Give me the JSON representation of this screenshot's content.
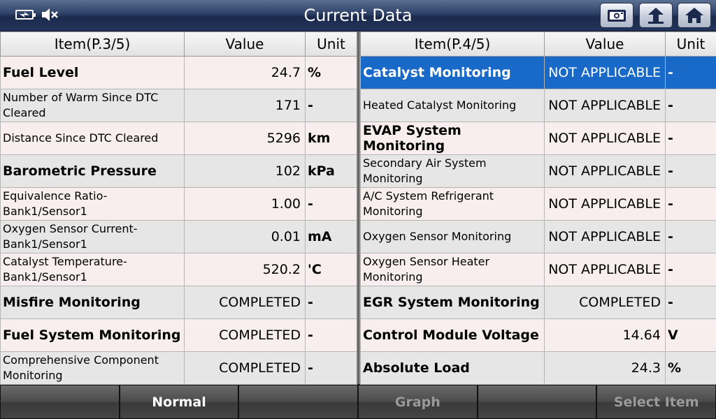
{
  "header": {
    "title": "Current Data",
    "icons": [
      "battery-charging-icon",
      "speaker-muted-icon"
    ],
    "buttons": [
      "screenshot-button",
      "back-button",
      "home-button"
    ]
  },
  "left_table": {
    "headers": {
      "item": "Item(P.3/5)",
      "value": "Value",
      "unit": "Unit"
    },
    "rows": [
      {
        "item": "Fuel Level",
        "value": "24.7",
        "unit": "%",
        "big": true
      },
      {
        "item": "Number of Warm Since DTC Cleared",
        "value": "171",
        "unit": "-"
      },
      {
        "item": "Distance Since DTC Cleared",
        "value": "5296",
        "unit": "km"
      },
      {
        "item": "Barometric Pressure",
        "value": "102",
        "unit": "kPa",
        "big": true
      },
      {
        "item": "Equivalence Ratio-Bank1/Sensor1",
        "value": "1.00",
        "unit": "-"
      },
      {
        "item": "Oxygen Sensor Current-Bank1/Sensor1",
        "value": "0.01",
        "unit": "mA"
      },
      {
        "item": "Catalyst Temperature-Bank1/Sensor1",
        "value": "520.2",
        "unit": "'C"
      },
      {
        "item": "Misfire Monitoring",
        "value": "COMPLETED",
        "unit": "-",
        "big": true
      },
      {
        "item": "Fuel System Monitoring",
        "value": "COMPLETED",
        "unit": "-",
        "big": true
      },
      {
        "item": "Comprehensive Component Monitoring",
        "value": "COMPLETED",
        "unit": "-"
      }
    ]
  },
  "right_table": {
    "headers": {
      "item": "Item(P.4/5)",
      "value": "Value",
      "unit": "Unit"
    },
    "rows": [
      {
        "item": "Catalyst Monitoring",
        "value": "NOT APPLICABLE",
        "unit": "-",
        "big": true,
        "selected": true
      },
      {
        "item": "Heated Catalyst Monitoring",
        "value": "NOT APPLICABLE",
        "unit": "-"
      },
      {
        "item": "EVAP System Monitoring",
        "value": "NOT APPLICABLE",
        "unit": "-",
        "big": true
      },
      {
        "item": "Secondary Air System Monitoring",
        "value": "NOT APPLICABLE",
        "unit": "-"
      },
      {
        "item": "A/C System Refrigerant Monitoring",
        "value": "NOT APPLICABLE",
        "unit": "-"
      },
      {
        "item": "Oxygen Sensor Monitoring",
        "value": "NOT APPLICABLE",
        "unit": "-"
      },
      {
        "item": "Oxygen Sensor Heater Monitoring",
        "value": "NOT APPLICABLE",
        "unit": "-"
      },
      {
        "item": "EGR System Monitoring",
        "value": "COMPLETED",
        "unit": "-",
        "big": true
      },
      {
        "item": "Control Module Voltage",
        "value": "14.64",
        "unit": "V",
        "big": true
      },
      {
        "item": "Absolute Load",
        "value": "24.3",
        "unit": "%",
        "big": true
      }
    ]
  },
  "footer": {
    "buttons": [
      {
        "label": "",
        "enabled": true
      },
      {
        "label": "Normal",
        "enabled": true
      },
      {
        "label": "",
        "enabled": true
      },
      {
        "label": "Graph",
        "enabled": false
      },
      {
        "label": "",
        "enabled": true
      },
      {
        "label": "Select Item",
        "enabled": false
      }
    ]
  },
  "colors": {
    "selected_row": "#1869c8",
    "title_bar": "#2e4066"
  }
}
